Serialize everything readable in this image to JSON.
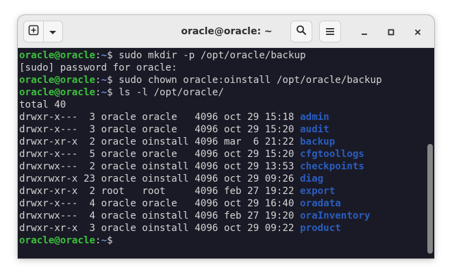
{
  "window": {
    "title": "oracle@oracle: ~"
  },
  "icons": {
    "new_tab": "new-tab-icon",
    "menu_dropdown": "chevron-down-icon",
    "search": "search-icon",
    "hamburger": "hamburger-menu-icon",
    "minimize": "minimize-icon",
    "maximize": "maximize-icon",
    "close": "close-icon"
  },
  "colors": {
    "prompt_user": "#3cc03c",
    "prompt_path": "#6c8cd5",
    "directory": "#2a5dbf",
    "text": "#d4d4d4",
    "background": "#1a1a26"
  },
  "terminal": {
    "lines": [
      {
        "type": "prompt",
        "user": "oracle@oracle",
        "sep": ":",
        "path": "~",
        "sym": "$ ",
        "cmd": "sudo mkdir -p /opt/oracle/backup"
      },
      {
        "type": "text",
        "text": "[sudo] password for oracle:"
      },
      {
        "type": "prompt",
        "user": "oracle@oracle",
        "sep": ":",
        "path": "~",
        "sym": "$ ",
        "cmd": "sudo chown oracle:oinstall /opt/oracle/backup"
      },
      {
        "type": "prompt",
        "user": "oracle@oracle",
        "sep": ":",
        "path": "~",
        "sym": "$ ",
        "cmd": "ls -l /opt/oracle/"
      },
      {
        "type": "text",
        "text": "total 40"
      },
      {
        "type": "ls",
        "meta": "drwxr-x---  3 oracle oracle   4096 oct 29 15:18 ",
        "name": "admin"
      },
      {
        "type": "ls",
        "meta": "drwxr-x---  3 oracle oracle   4096 oct 29 15:20 ",
        "name": "audit"
      },
      {
        "type": "ls",
        "meta": "drwxr-xr-x  2 oracle oinstall 4096 mar  6 21:22 ",
        "name": "backup"
      },
      {
        "type": "ls",
        "meta": "drwxr-x---  5 oracle oracle   4096 oct 29 15:20 ",
        "name": "cfgtoollogs"
      },
      {
        "type": "ls",
        "meta": "drwxrwx---  2 oracle oinstall 4096 oct 29 13:53 ",
        "name": "checkpoints"
      },
      {
        "type": "ls",
        "meta": "drwxrwxr-x 23 oracle oinstall 4096 oct 29 09:26 ",
        "name": "diag"
      },
      {
        "type": "ls",
        "meta": "drwxr-xr-x  2 root   root     4096 feb 27 19:22 ",
        "name": "export"
      },
      {
        "type": "ls",
        "meta": "drwxr-x---  4 oracle oracle   4096 oct 29 16:40 ",
        "name": "oradata"
      },
      {
        "type": "ls",
        "meta": "drwxrwx---  4 oracle oinstall 4096 feb 27 19:20 ",
        "name": "oraInventory"
      },
      {
        "type": "ls",
        "meta": "drwxr-xr-x  3 oracle oinstall 4096 oct 29 09:22 ",
        "name": "product"
      },
      {
        "type": "prompt",
        "user": "oracle@oracle",
        "sep": ":",
        "path": "~",
        "sym": "$ ",
        "cmd": ""
      }
    ]
  }
}
